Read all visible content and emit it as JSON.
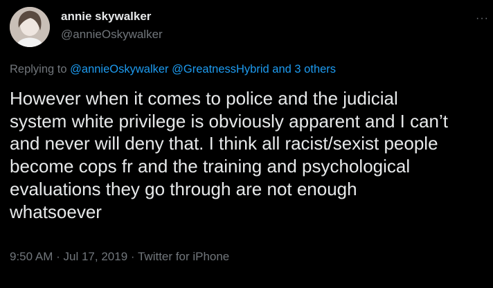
{
  "author": {
    "display_name": "annie skywalker",
    "handle": "@annieOskywalker",
    "avatar_icon": "profile-photo"
  },
  "menu": {
    "icon": "more-options-icon",
    "glyph": "···"
  },
  "reply_context": {
    "prefix": "Replying to",
    "mention_1": "@annieOskywalker",
    "mention_2": "@GreatnessHybrid",
    "and_word": "and",
    "others": "3 others"
  },
  "tweet": {
    "lines": [
      "However when it comes to police and the judicial",
      "system white privilege is obviously apparent and I can’t",
      "and never will deny that. I think all racist/sexist people",
      "become cops fr and the training and psychological",
      "evaluations they go through are not enough",
      "whatsoever"
    ]
  },
  "meta": {
    "time": "9:50 AM",
    "date": "Jul 17, 2019",
    "source": "Twitter for iPhone",
    "separator": "·"
  },
  "colors": {
    "background": "#000000",
    "text": "#e7e9ea",
    "secondary": "#71767b",
    "link": "#1d9bf0"
  }
}
